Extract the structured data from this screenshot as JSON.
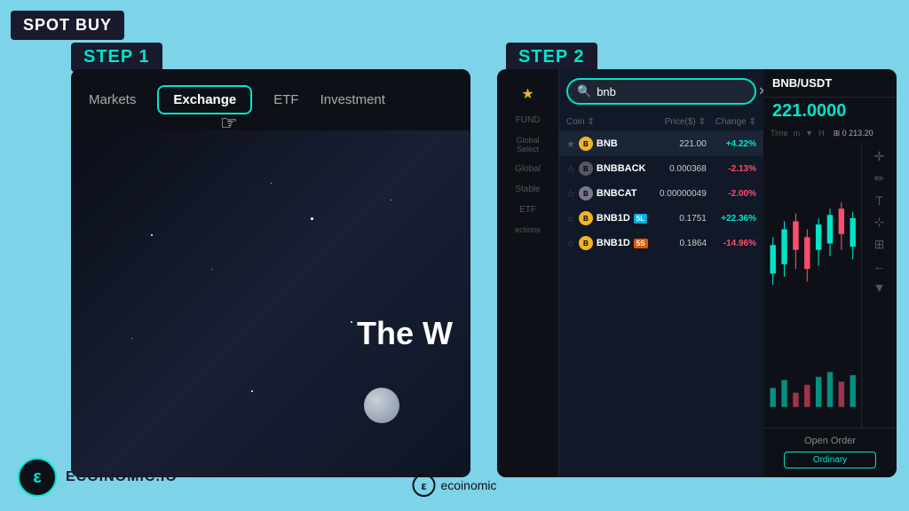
{
  "badge": {
    "text": "SPOT BUY"
  },
  "step1": {
    "label": "STEP 1",
    "nav": {
      "items": [
        {
          "id": "markets",
          "label": "Markets",
          "active": false
        },
        {
          "id": "exchange",
          "label": "Exchange",
          "active": true
        },
        {
          "id": "etf",
          "label": "ETF",
          "active": false
        },
        {
          "id": "investment",
          "label": "Investment",
          "active": false
        }
      ]
    },
    "hero_text": "The W"
  },
  "step2": {
    "label": "STEP 2",
    "search": {
      "placeholder": "bnb",
      "value": "bnb",
      "clear_icon": "✕"
    },
    "table": {
      "headers": {
        "coin": "Coin ⇕",
        "price": "Price($) ⇕",
        "change": "Change ⇕"
      },
      "rows": [
        {
          "coin": "BNB",
          "price": "221.00",
          "change": "+4.22%",
          "positive": true,
          "highlighted": true
        },
        {
          "coin": "BNBBACK",
          "price": "0.000368",
          "change": "-2.13%",
          "positive": false
        },
        {
          "coin": "BNBCAT",
          "price": "0.00000049",
          "change": "-2.00%",
          "positive": false
        },
        {
          "coin": "BNB1D",
          "badge": "5L",
          "badge_type": "5l",
          "price": "0.1751",
          "change": "+22.36%",
          "positive": true
        },
        {
          "coin": "BNB1D",
          "badge": "5S",
          "badge_type": "5s",
          "price": "0.1864",
          "change": "-14.96%",
          "positive": false
        }
      ]
    },
    "sidebar_menu": [
      "FUND",
      "Global\nSelect",
      "Global",
      "Stable",
      "ETF",
      "ections"
    ],
    "chart": {
      "pair": "BNB/USDT",
      "price": "221.0000",
      "ref_price": "0 213.20",
      "controls": [
        "Time",
        "m",
        "▼",
        "H"
      ],
      "order_title": "Open Order",
      "order_btn": "Ordinary"
    }
  },
  "footer": {
    "logo_text": "ECOINOMIC.IO",
    "ecoinomic_label": "ecoinomic"
  }
}
